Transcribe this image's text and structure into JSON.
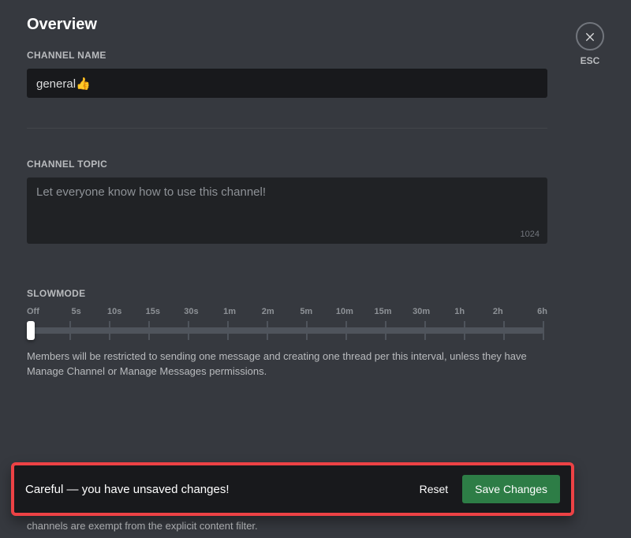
{
  "header": {
    "title": "Overview",
    "close_escape_label": "ESC"
  },
  "channel_name": {
    "label": "CHANNEL NAME",
    "value": "general👍"
  },
  "channel_topic": {
    "label": "CHANNEL TOPIC",
    "placeholder": "Let everyone know how to use this channel!",
    "value": "",
    "remaining": "1024"
  },
  "slowmode": {
    "label": "SLOWMODE",
    "ticks": [
      "Off",
      "5s",
      "10s",
      "15s",
      "30s",
      "1m",
      "2m",
      "5m",
      "10m",
      "15m",
      "30m",
      "1h",
      "2h",
      "6h"
    ],
    "value_index": 0,
    "help": "Members will be restricted to sending one message and creating one thread per this interval, unless they have Manage Channel or Manage Messages permissions."
  },
  "background_fragment": "channels are exempt from the explicit content filter.",
  "unsaved_toast": {
    "message": "Careful — you have unsaved changes!",
    "reset_label": "Reset",
    "save_label": "Save Changes"
  }
}
